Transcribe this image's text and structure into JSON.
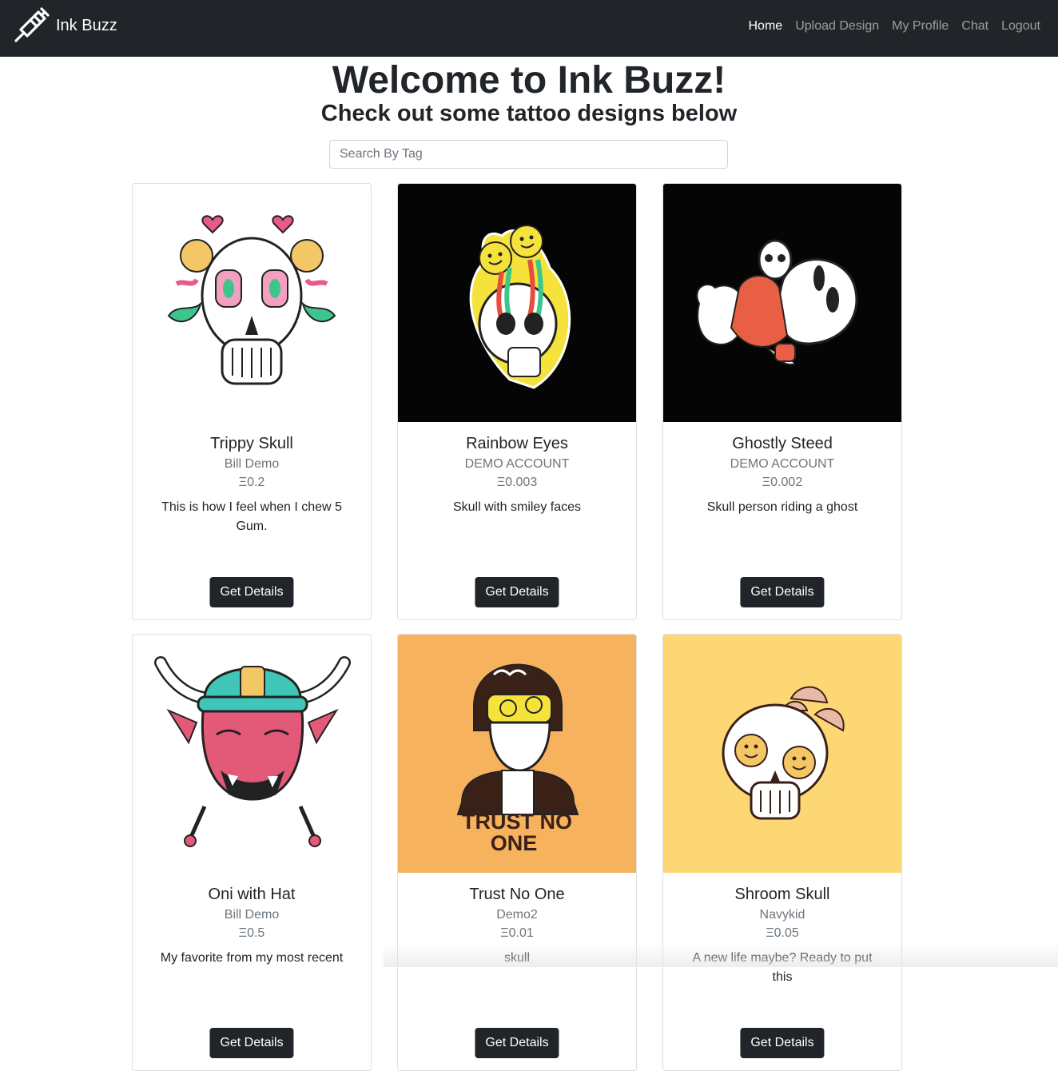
{
  "brand": {
    "name": "Ink Buzz",
    "icon": "tattoo-machine-icon"
  },
  "nav": [
    {
      "label": "Home",
      "active": true
    },
    {
      "label": "Upload Design",
      "active": false
    },
    {
      "label": "My Profile",
      "active": false
    },
    {
      "label": "Chat",
      "active": false
    },
    {
      "label": "Logout",
      "active": false
    }
  ],
  "hero": {
    "title": "Welcome to Ink Buzz!",
    "subtitle": "Check out some tattoo designs below"
  },
  "search": {
    "placeholder": "Search By Tag",
    "value": ""
  },
  "cards": [
    {
      "title": "Trippy Skull",
      "artist": "Bill Demo",
      "price": "Ξ0.2",
      "description": "This is how I feel when I chew 5 Gum.",
      "button": "Get Details",
      "image_bg": "#ffffff"
    },
    {
      "title": "Rainbow Eyes",
      "artist": "DEMO ACCOUNT",
      "price": "Ξ0.003",
      "description": "Skull with smiley faces",
      "button": "Get Details",
      "image_bg": "#050505"
    },
    {
      "title": "Ghostly Steed",
      "artist": "DEMO ACCOUNT",
      "price": "Ξ0.002",
      "description": "Skull person riding a ghost",
      "button": "Get Details",
      "image_bg": "#050505"
    },
    {
      "title": "Oni with Hat",
      "artist": "Bill Demo",
      "price": "Ξ0.5",
      "description": "My favorite from my most recent",
      "button": "Get Details",
      "image_bg": "#ffffff"
    },
    {
      "title": "Trust No One",
      "artist": "Demo2",
      "price": "Ξ0.01",
      "description": "skull",
      "button": "Get Details",
      "image_bg": "#f7b25e",
      "image_text": "TRUST NO ONE"
    },
    {
      "title": "Shroom Skull",
      "artist": "Navykid",
      "price": "Ξ0.05",
      "description": "A new life maybe? Ready to put this",
      "button": "Get Details",
      "image_bg": "#fdd774"
    }
  ]
}
